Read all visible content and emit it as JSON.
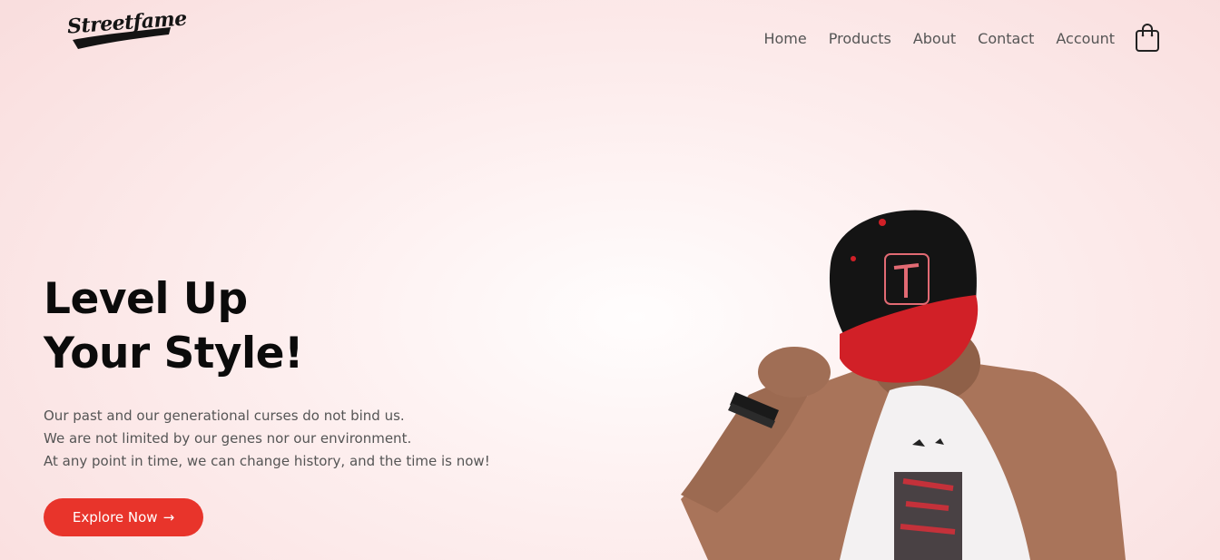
{
  "brand": {
    "logo_text": "Streetfame"
  },
  "nav": {
    "links": [
      "Home",
      "Products",
      "About",
      "Contact",
      "Account"
    ],
    "cart_icon": "shopping-bag-icon"
  },
  "hero": {
    "title_line1": "Level Up",
    "title_line2": "Your Style!",
    "paragraph": [
      "Our past and our generational curses do not bind us.",
      "We are not limited by our genes nor our environment.",
      "At any point in time, we can change history, and the time is now!"
    ],
    "cta_label": "Explore Now",
    "cta_arrow": "→"
  },
  "colors": {
    "accent": "#e8342b",
    "background": "#fbe6e6",
    "text_dark": "#0b0b0b",
    "text_muted": "#555555"
  }
}
